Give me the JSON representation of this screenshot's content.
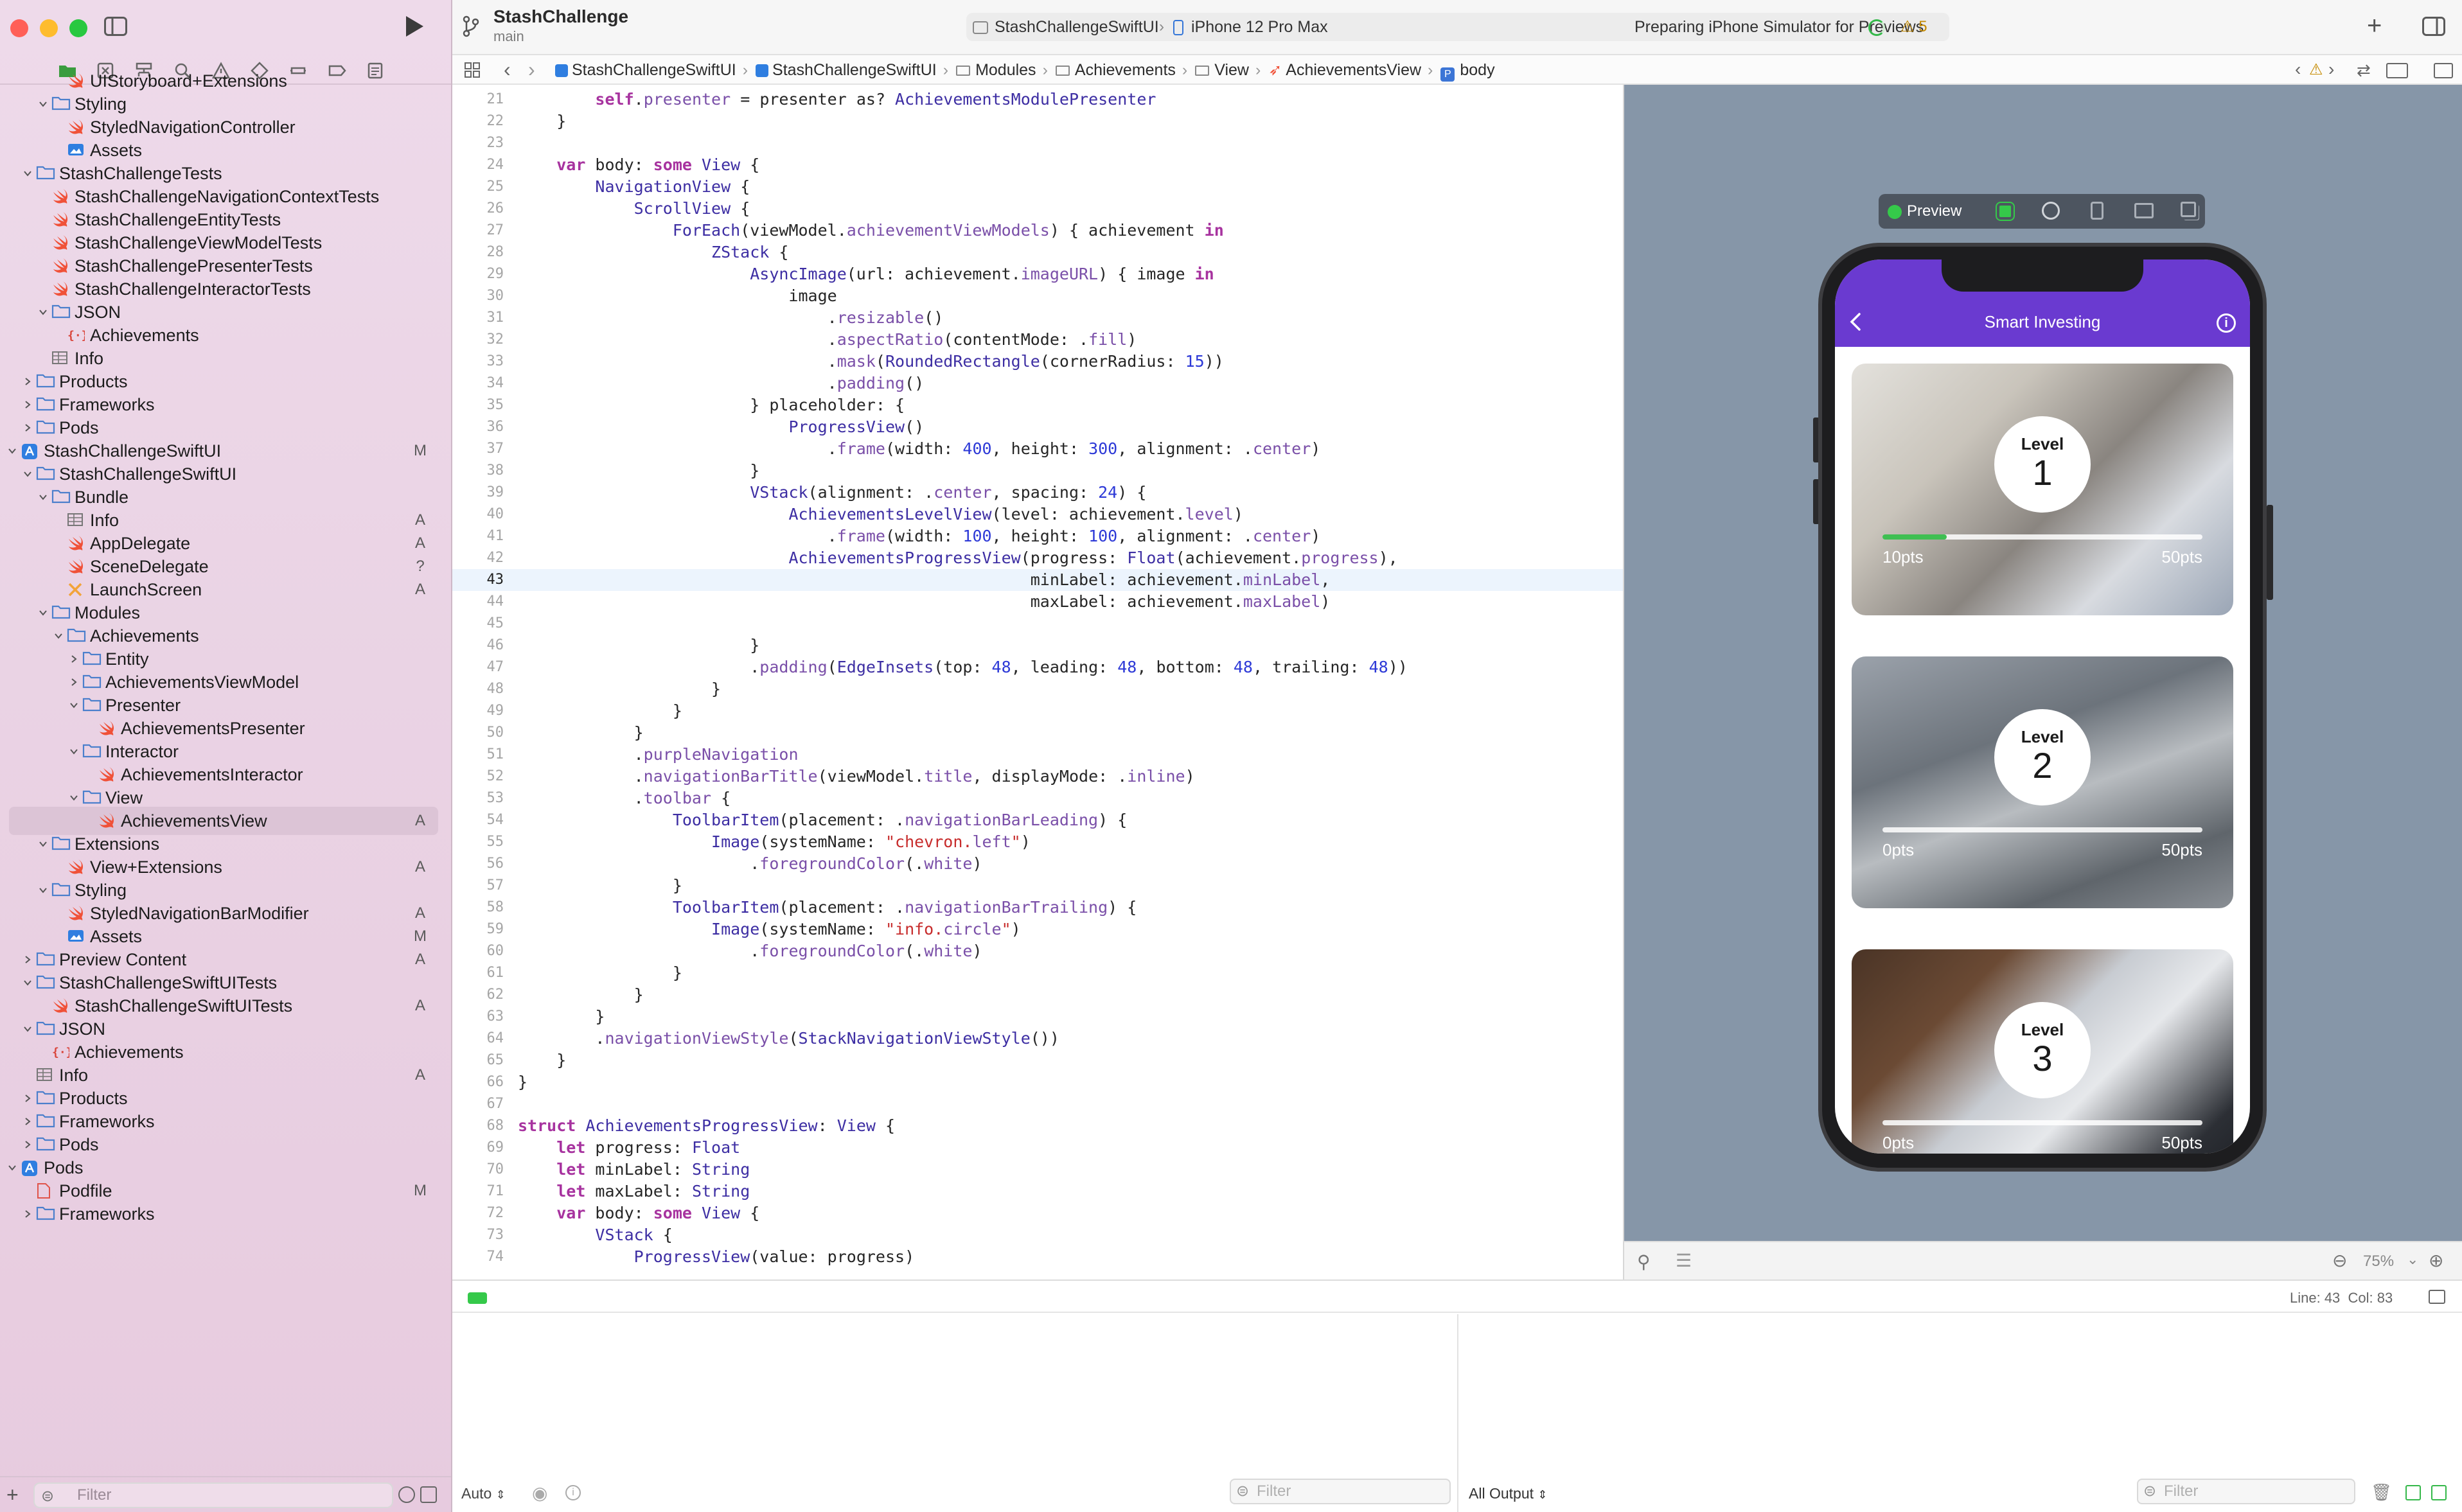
{
  "window": {
    "project": "StashChallenge",
    "branch": "main"
  },
  "toolbar": {
    "scheme": "StashChallengeSwiftUI",
    "device": "iPhone 12 Pro Max",
    "status": "Preparing iPhone Simulator for Previews",
    "warnings": "5"
  },
  "jumpbar": {
    "crumbs": [
      "StashChallengeSwiftUI",
      "StashChallengeSwiftUI",
      "Modules",
      "Achievements",
      "View",
      "AchievementsView",
      "body"
    ]
  },
  "tree": [
    {
      "label": "UIStoryboard+Extensions",
      "indent": 3,
      "icon": "swift",
      "exp": "",
      "badge": ""
    },
    {
      "label": "Styling",
      "indent": 2,
      "icon": "folder",
      "exp": "open",
      "badge": ""
    },
    {
      "label": "StyledNavigationController",
      "indent": 3,
      "icon": "swift",
      "exp": "",
      "badge": ""
    },
    {
      "label": "Assets",
      "indent": 3,
      "icon": "assets",
      "exp": "",
      "badge": ""
    },
    {
      "label": "StashChallengeTests",
      "indent": 1,
      "icon": "folder",
      "exp": "open",
      "badge": ""
    },
    {
      "label": "StashChallengeNavigationContextTests",
      "indent": 2,
      "icon": "swift",
      "exp": "",
      "badge": ""
    },
    {
      "label": "StashChallengeEntityTests",
      "indent": 2,
      "icon": "swift",
      "exp": "",
      "badge": ""
    },
    {
      "label": "StashChallengeViewModelTests",
      "indent": 2,
      "icon": "swift",
      "exp": "",
      "badge": ""
    },
    {
      "label": "StashChallengePresenterTests",
      "indent": 2,
      "icon": "swift",
      "exp": "",
      "badge": ""
    },
    {
      "label": "StashChallengeInteractorTests",
      "indent": 2,
      "icon": "swift",
      "exp": "",
      "badge": ""
    },
    {
      "label": "JSON",
      "indent": 2,
      "icon": "folder",
      "exp": "open",
      "badge": ""
    },
    {
      "label": "Achievements",
      "indent": 3,
      "icon": "json",
      "exp": "",
      "badge": ""
    },
    {
      "label": "Info",
      "indent": 2,
      "icon": "table",
      "exp": "",
      "badge": ""
    },
    {
      "label": "Products",
      "indent": 1,
      "icon": "folder",
      "exp": "closed",
      "badge": ""
    },
    {
      "label": "Frameworks",
      "indent": 1,
      "icon": "folder",
      "exp": "closed",
      "badge": ""
    },
    {
      "label": "Pods",
      "indent": 1,
      "icon": "folder",
      "exp": "closed",
      "badge": ""
    },
    {
      "label": "StashChallengeSwiftUI",
      "indent": 0,
      "icon": "project",
      "exp": "open",
      "badge": "M"
    },
    {
      "label": "StashChallengeSwiftUI",
      "indent": 1,
      "icon": "folder",
      "exp": "open",
      "badge": ""
    },
    {
      "label": "Bundle",
      "indent": 2,
      "icon": "folder",
      "exp": "open",
      "badge": ""
    },
    {
      "label": "Info",
      "indent": 3,
      "icon": "table",
      "exp": "",
      "badge": "A"
    },
    {
      "label": "AppDelegate",
      "indent": 3,
      "icon": "swift",
      "exp": "",
      "badge": "A"
    },
    {
      "label": "SceneDelegate",
      "indent": 3,
      "icon": "swift",
      "exp": "",
      "badge": "?"
    },
    {
      "label": "LaunchScreen",
      "indent": 3,
      "icon": "xib",
      "exp": "",
      "badge": "A"
    },
    {
      "label": "Modules",
      "indent": 2,
      "icon": "folder",
      "exp": "open",
      "badge": ""
    },
    {
      "label": "Achievements",
      "indent": 3,
      "icon": "folder",
      "exp": "open",
      "badge": ""
    },
    {
      "label": "Entity",
      "indent": 4,
      "icon": "folder",
      "exp": "closed",
      "badge": ""
    },
    {
      "label": "AchievementsViewModel",
      "indent": 4,
      "icon": "folder",
      "exp": "closed",
      "badge": ""
    },
    {
      "label": "Presenter",
      "indent": 4,
      "icon": "folder",
      "exp": "open",
      "badge": ""
    },
    {
      "label": "AchievementsPresenter",
      "indent": 5,
      "icon": "swift",
      "exp": "",
      "badge": ""
    },
    {
      "label": "Interactor",
      "indent": 4,
      "icon": "folder",
      "exp": "open",
      "badge": ""
    },
    {
      "label": "AchievementsInteractor",
      "indent": 5,
      "icon": "swift",
      "exp": "",
      "badge": ""
    },
    {
      "label": "View",
      "indent": 4,
      "icon": "folder",
      "exp": "open",
      "badge": ""
    },
    {
      "label": "AchievementsView",
      "indent": 5,
      "icon": "swift",
      "exp": "",
      "badge": "A",
      "selected": true
    },
    {
      "label": "Extensions",
      "indent": 2,
      "icon": "folder",
      "exp": "open",
      "badge": ""
    },
    {
      "label": "View+Extensions",
      "indent": 3,
      "icon": "swift",
      "exp": "",
      "badge": "A"
    },
    {
      "label": "Styling",
      "indent": 2,
      "icon": "folder",
      "exp": "open",
      "badge": ""
    },
    {
      "label": "StyledNavigationBarModifier",
      "indent": 3,
      "icon": "swift",
      "exp": "",
      "badge": "A"
    },
    {
      "label": "Assets",
      "indent": 3,
      "icon": "assets",
      "exp": "",
      "badge": "M"
    },
    {
      "label": "Preview Content",
      "indent": 1,
      "icon": "folder",
      "exp": "closed",
      "badge": "A"
    },
    {
      "label": "StashChallengeSwiftUITests",
      "indent": 1,
      "icon": "folder",
      "exp": "open",
      "badge": ""
    },
    {
      "label": "StashChallengeSwiftUITests",
      "indent": 2,
      "icon": "swift",
      "exp": "",
      "badge": "A"
    },
    {
      "label": "JSON",
      "indent": 1,
      "icon": "folder",
      "exp": "open",
      "badge": ""
    },
    {
      "label": "Achievements",
      "indent": 2,
      "icon": "json",
      "exp": "",
      "badge": ""
    },
    {
      "label": "Info",
      "indent": 1,
      "icon": "table",
      "exp": "",
      "badge": "A"
    },
    {
      "label": "Products",
      "indent": 1,
      "icon": "folder",
      "exp": "closed",
      "badge": ""
    },
    {
      "label": "Frameworks",
      "indent": 1,
      "icon": "folder",
      "exp": "closed",
      "badge": ""
    },
    {
      "label": "Pods",
      "indent": 1,
      "icon": "folder",
      "exp": "closed",
      "badge": ""
    },
    {
      "label": "Pods",
      "indent": 0,
      "icon": "project",
      "exp": "open",
      "badge": ""
    },
    {
      "label": "Podfile",
      "indent": 1,
      "icon": "podfile",
      "exp": "",
      "badge": "M"
    },
    {
      "label": "Frameworks",
      "indent": 1,
      "icon": "folder",
      "exp": "closed",
      "badge": ""
    }
  ],
  "sidebar_filter": {
    "placeholder": "Filter"
  },
  "code": {
    "current_line": 43,
    "lines": [
      {
        "n": 21,
        "t": "        self.presenter = presenter as? AchievementsModulePresenter"
      },
      {
        "n": 22,
        "t": "    }"
      },
      {
        "n": 23,
        "t": ""
      },
      {
        "n": 24,
        "t": "    var body: some View {"
      },
      {
        "n": 25,
        "t": "        NavigationView {"
      },
      {
        "n": 26,
        "t": "            ScrollView {"
      },
      {
        "n": 27,
        "t": "                ForEach(viewModel.achievementViewModels) { achievement in"
      },
      {
        "n": 28,
        "t": "                    ZStack {"
      },
      {
        "n": 29,
        "t": "                        AsyncImage(url: achievement.imageURL) { image in"
      },
      {
        "n": 30,
        "t": "                            image"
      },
      {
        "n": 31,
        "t": "                                .resizable()"
      },
      {
        "n": 32,
        "t": "                                .aspectRatio(contentMode: .fill)"
      },
      {
        "n": 33,
        "t": "                                .mask(RoundedRectangle(cornerRadius: 15))"
      },
      {
        "n": 34,
        "t": "                                .padding()"
      },
      {
        "n": 35,
        "t": "                        } placeholder: {"
      },
      {
        "n": 36,
        "t": "                            ProgressView()"
      },
      {
        "n": 37,
        "t": "                                .frame(width: 400, height: 300, alignment: .center)"
      },
      {
        "n": 38,
        "t": "                        }"
      },
      {
        "n": 39,
        "t": "                        VStack(alignment: .center, spacing: 24) {"
      },
      {
        "n": 40,
        "t": "                            AchievementsLevelView(level: achievement.level)"
      },
      {
        "n": 41,
        "t": "                                .frame(width: 100, height: 100, alignment: .center)"
      },
      {
        "n": 42,
        "t": "                            AchievementsProgressView(progress: Float(achievement.progress),"
      },
      {
        "n": 43,
        "t": "                                                     minLabel: achievement.minLabel,"
      },
      {
        "n": 44,
        "t": "                                                     maxLabel: achievement.maxLabel)"
      },
      {
        "n": 45,
        "t": ""
      },
      {
        "n": 46,
        "t": "                        }"
      },
      {
        "n": 47,
        "t": "                        .padding(EdgeInsets(top: 48, leading: 48, bottom: 48, trailing: 48))"
      },
      {
        "n": 48,
        "t": "                    }"
      },
      {
        "n": 49,
        "t": "                }"
      },
      {
        "n": 50,
        "t": "            }"
      },
      {
        "n": 51,
        "t": "            .purpleNavigation"
      },
      {
        "n": 52,
        "t": "            .navigationBarTitle(viewModel.title, displayMode: .inline)"
      },
      {
        "n": 53,
        "t": "            .toolbar {"
      },
      {
        "n": 54,
        "t": "                ToolbarItem(placement: .navigationBarLeading) {"
      },
      {
        "n": 55,
        "t": "                    Image(systemName: \"chevron.left\")"
      },
      {
        "n": 56,
        "t": "                        .foregroundColor(.white)"
      },
      {
        "n": 57,
        "t": "                }"
      },
      {
        "n": 58,
        "t": "                ToolbarItem(placement: .navigationBarTrailing) {"
      },
      {
        "n": 59,
        "t": "                    Image(systemName: \"info.circle\")"
      },
      {
        "n": 60,
        "t": "                        .foregroundColor(.white)"
      },
      {
        "n": 61,
        "t": "                }"
      },
      {
        "n": 62,
        "t": "            }"
      },
      {
        "n": 63,
        "t": "        }"
      },
      {
        "n": 64,
        "t": "        .navigationViewStyle(StackNavigationViewStyle())"
      },
      {
        "n": 65,
        "t": "    }"
      },
      {
        "n": 66,
        "t": "}"
      },
      {
        "n": 67,
        "t": ""
      },
      {
        "n": 68,
        "t": "struct AchievementsProgressView: View {"
      },
      {
        "n": 69,
        "t": "    let progress: Float"
      },
      {
        "n": 70,
        "t": "    let minLabel: String"
      },
      {
        "n": 71,
        "t": "    let maxLabel: String"
      },
      {
        "n": 72,
        "t": "    var body: some View {"
      },
      {
        "n": 73,
        "t": "        VStack {"
      },
      {
        "n": 74,
        "t": "            ProgressView(value: progress)"
      }
    ]
  },
  "preview": {
    "label": "Preview",
    "zoom": "75%",
    "app_title": "Smart Investing",
    "cards": [
      {
        "level_label": "Level",
        "level": "1",
        "min": "10pts",
        "max": "50pts",
        "progress": 0.2
      },
      {
        "level_label": "Level",
        "level": "2",
        "min": "0pts",
        "max": "50pts",
        "progress": 0.0
      },
      {
        "level_label": "Level",
        "level": "3",
        "min": "0pts",
        "max": "50pts",
        "progress": 0.0
      }
    ]
  },
  "status_bar": {
    "position": "Line: 43  Col: 83"
  },
  "debug": {
    "mode": "Auto",
    "output": "All Output",
    "filter_left": "Filter",
    "filter_right": "Filter"
  },
  "colors": {
    "accent": "#6535c4",
    "nav_purple": "#6a3ad0",
    "progress_green": "#3fbf52",
    "canvas": "#8696a8"
  }
}
